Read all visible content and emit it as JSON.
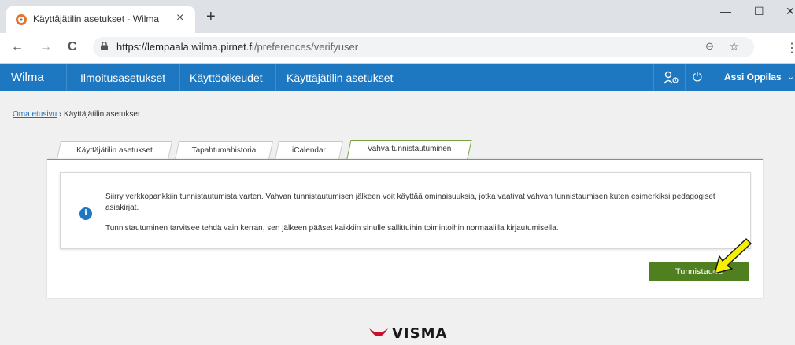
{
  "browser": {
    "tab_title": "Käyttäjätilin asetukset - Wilma",
    "tab_close": "×",
    "new_tab": "+",
    "window_min": "—",
    "window_max": "☐",
    "window_close": "✕",
    "url_host": "https://lempaala.wilma.pirnet.fi",
    "url_path": "/preferences/verifyuser",
    "back": "←",
    "forward": "→",
    "reload": "C",
    "zoom": "⊖",
    "bookmark": "☆",
    "menu": "⋮"
  },
  "app": {
    "brand": "Wilma",
    "nav": [
      "Ilmoitusasetukset",
      "Käyttöoikeudet",
      "Käyttäjätilin asetukset"
    ],
    "roles_icon": "roles-icon",
    "power_icon": "⏻",
    "user": "Assi Oppilas",
    "caret": "⌄"
  },
  "breadcrumb": {
    "home": "Oma etusivu",
    "separator": "›",
    "current": "Käyttäjätilin asetukset"
  },
  "tabs": [
    "Käyttäjätilin asetukset",
    "Tapahtumahistoria",
    "iCalendar",
    "Vahva tunnistautuminen"
  ],
  "active_tab": "Vahva tunnistautuminen",
  "info": {
    "icon": "i",
    "paragraph1": "Siirry verkkopankkiin tunnistautumista varten. Vahvan tunnistautumisen jälkeen voit käyttää ominaisuuksia, jotka vaativat vahvan tunnistaumisen kuten esimerkiksi pedagogiset asiakirjat.",
    "paragraph2": "Tunnistautuminen tarvitsee tehdä vain kerran, sen jälkeen pääset kaikkiin sinulle sallittuihin toimintoihin normaalilla kirjautumisella."
  },
  "button": {
    "authenticate": "Tunnistaudu"
  },
  "footer": {
    "logo_text": "VISMA"
  },
  "colors": {
    "header_blue": "#1d78c1",
    "tab_green": "#78a33e",
    "button_green": "#4f7f1f",
    "arrow_yellow": "#f4f000"
  }
}
